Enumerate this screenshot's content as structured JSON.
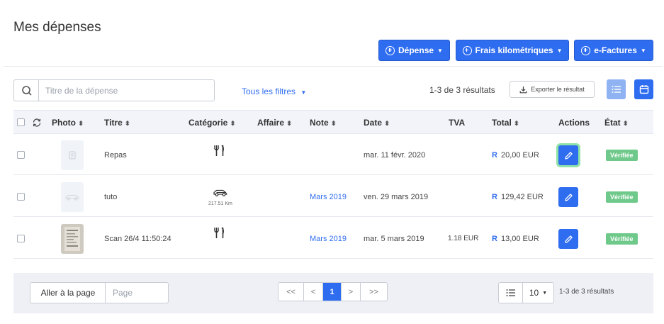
{
  "header": {
    "title": "Mes dépenses",
    "buttons": {
      "depense": "Dépense",
      "frais": "Frais kilométriques",
      "efactures": "e-Factures"
    }
  },
  "toolbar": {
    "search_placeholder": "Titre de la dépense",
    "filters_label": "Tous les filtres",
    "results_count": "1-3 de 3 résultats",
    "export_label": "Exporter le résultat"
  },
  "table": {
    "headers": {
      "photo": "Photo",
      "titre": "Titre",
      "categorie": "Catégorie",
      "affaire": "Affaire",
      "note": "Note",
      "date": "Date",
      "tva": "TVA",
      "total": "Total",
      "actions": "Actions",
      "etat": "État"
    },
    "rows": [
      {
        "titre": "Repas",
        "categorie_icon": "fork-knife-icon",
        "categorie_sub": "",
        "note": "",
        "date": "mar. 11 févr. 2020",
        "tva": "",
        "currency": "R",
        "total": "20,00 EUR",
        "etat": "Vérifiée"
      },
      {
        "titre": "tuto",
        "categorie_icon": "car-icon",
        "categorie_sub": "217.51 Km",
        "note": "Mars 2019",
        "date": "ven. 29 mars 2019",
        "tva": "",
        "currency": "R",
        "total": "129,42 EUR",
        "etat": "Vérifiée"
      },
      {
        "titre": "Scan 26/4 11:50:24",
        "categorie_icon": "fork-knife-icon",
        "categorie_sub": "",
        "note": "Mars 2019",
        "date": "mar. 5 mars 2019",
        "tva": "1.18 EUR",
        "currency": "R",
        "total": "13,00 EUR",
        "etat": "Vérifiée"
      }
    ]
  },
  "footer": {
    "goto_label": "Aller à la page",
    "goto_placeholder": "Page",
    "pager": {
      "first": "<<",
      "prev": "<",
      "current": "1",
      "next": ">",
      "last": ">>"
    },
    "per_page": "10",
    "results_count": "1-3 de 3 résultats"
  },
  "colors": {
    "primary": "#2f6df0",
    "verified": "#6fc98a",
    "highlight": "#8ee3a6"
  }
}
